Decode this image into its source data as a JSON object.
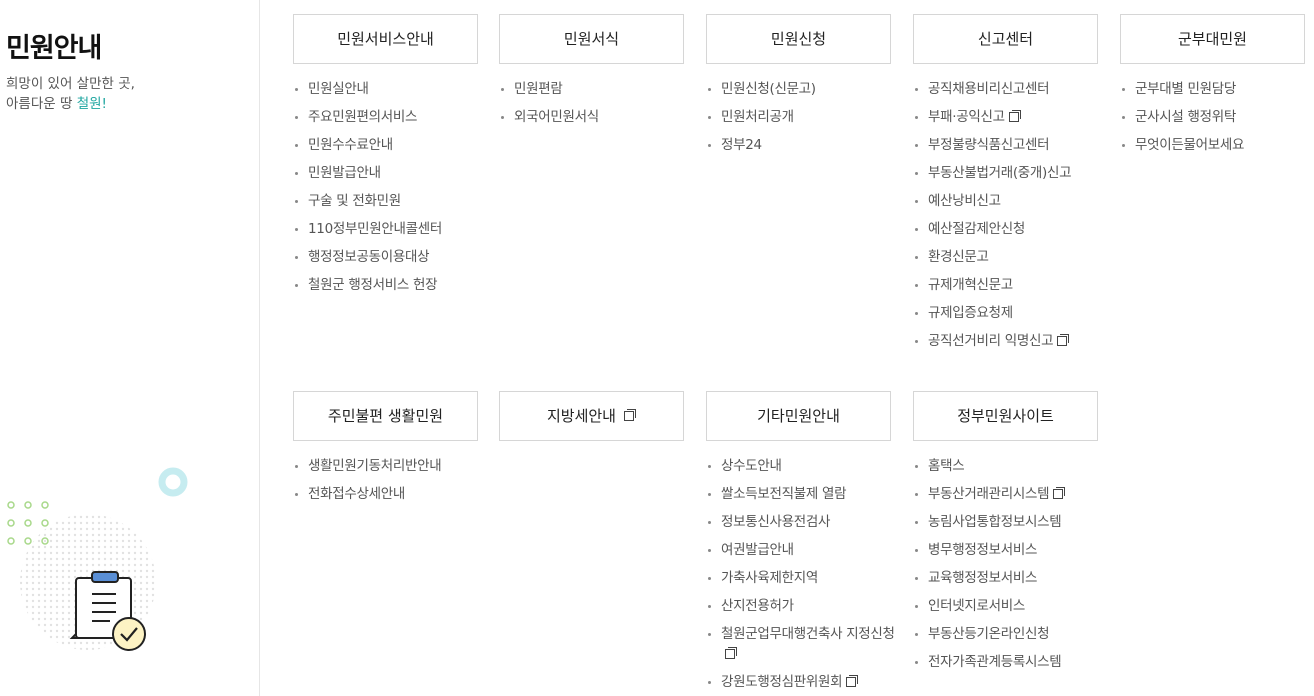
{
  "sidebar": {
    "title": "민원안내",
    "desc_line1": "희망이 있어 살만한 곳,",
    "desc_line2_prefix": "아름다운 땅 ",
    "desc_line2_accent": "철원!"
  },
  "sections": [
    {
      "title": "민원서비스안내",
      "items": [
        {
          "label": "민원실안내"
        },
        {
          "label": "주요민원편의서비스"
        },
        {
          "label": "민원수수료안내"
        },
        {
          "label": "민원발급안내"
        },
        {
          "label": "구술 및 전화민원"
        },
        {
          "label": "110정부민원안내콜센터"
        },
        {
          "label": "행정정보공동이용대상"
        },
        {
          "label": "철원군 행정서비스 헌장"
        }
      ]
    },
    {
      "title": "민원서식",
      "items": [
        {
          "label": "민원편람"
        },
        {
          "label": "외국어민원서식"
        }
      ]
    },
    {
      "title": "민원신청",
      "items": [
        {
          "label": "민원신청(신문고)"
        },
        {
          "label": "민원처리공개"
        },
        {
          "label": "정부24"
        }
      ]
    },
    {
      "title": "신고센터",
      "items": [
        {
          "label": "공직채용비리신고센터"
        },
        {
          "label": "부패·공익신고",
          "external": true
        },
        {
          "label": "부정불량식품신고센터"
        },
        {
          "label": "부동산불법거래(중개)신고"
        },
        {
          "label": "예산낭비신고"
        },
        {
          "label": "예산절감제안신청"
        },
        {
          "label": "환경신문고"
        },
        {
          "label": "규제개혁신문고"
        },
        {
          "label": "규제입증요청제"
        },
        {
          "label": "공직선거비리 익명신고",
          "external": true
        }
      ]
    },
    {
      "title": "군부대민원",
      "items": [
        {
          "label": "군부대별 민원담당"
        },
        {
          "label": "군사시설 행정위탁"
        },
        {
          "label": "무엇이든물어보세요"
        }
      ]
    },
    {
      "title": "주민불편 생활민원",
      "items": [
        {
          "label": "생활민원기동처리반안내"
        },
        {
          "label": "전화접수상세안내"
        }
      ]
    },
    {
      "title": "지방세안내",
      "external": true,
      "items": []
    },
    {
      "title": "기타민원안내",
      "items": [
        {
          "label": "상수도안내"
        },
        {
          "label": "쌀소득보전직불제 열람"
        },
        {
          "label": "정보통신사용전검사"
        },
        {
          "label": "여권발급안내"
        },
        {
          "label": "가축사육제한지역"
        },
        {
          "label": "산지전용허가"
        },
        {
          "label": "철원군업무대행건축사 지정신청",
          "external": true
        },
        {
          "label": "강원도행정심판위원회",
          "external": true
        }
      ]
    },
    {
      "title": "정부민원사이트",
      "items": [
        {
          "label": "홈택스"
        },
        {
          "label": "부동산거래관리시스템",
          "external": true
        },
        {
          "label": "농림사업통합정보시스템"
        },
        {
          "label": "병무행정정보서비스"
        },
        {
          "label": "교육행정정보서비스"
        },
        {
          "label": "인터넷지로서비스"
        },
        {
          "label": "부동산등기온라인신청"
        },
        {
          "label": "전자가족관계등록시스템"
        }
      ]
    }
  ],
  "colors": {
    "accent": "#1fa6a0",
    "border": "#d6d6d6",
    "text": "#555555"
  }
}
